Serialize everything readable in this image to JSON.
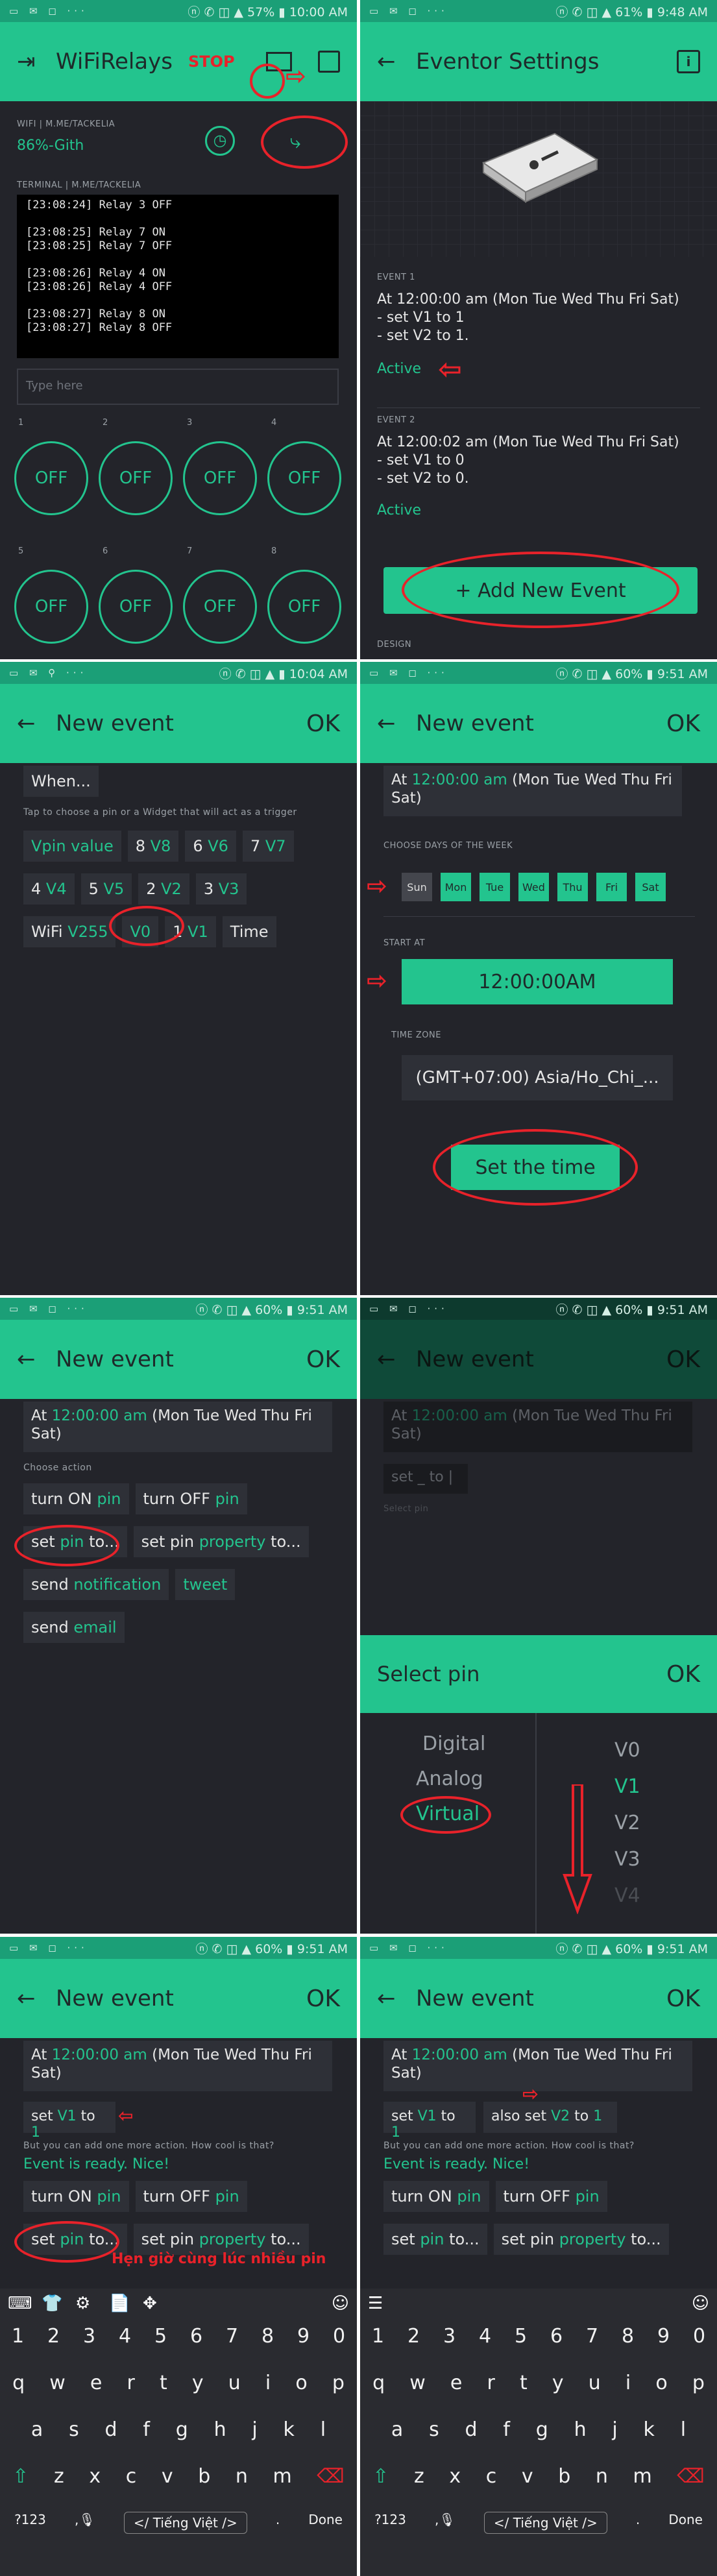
{
  "p1": {
    "status_left": "▭ ✉ ◻ ···",
    "status_right": "ⓝ ✆ ◫ ▲ 57% ▮ 10:00 AM",
    "title": "WiFiRelays",
    "stop_annotation": "STOP",
    "badge": "",
    "wifi_label": "WIFI | M.ME/TACKELIA",
    "wifi_value": "86%-Gith",
    "terminal_label": "TERMINAL | M.ME/TACKELIA",
    "terminal_lines": [
      "[23:08:24] Relay 3 OFF",
      "",
      "[23:08:25] Relay 7 ON",
      "[23:08:25] Relay 7 OFF",
      "",
      "[23:08:26] Relay 4 ON",
      "[23:08:26] Relay 4 OFF",
      "",
      "[23:08:27] Relay 8 ON",
      "[23:08:27] Relay 8 OFF"
    ],
    "type_here": "Type here",
    "knobs": [
      {
        "num": "1",
        "label": "OFF"
      },
      {
        "num": "2",
        "label": "OFF"
      },
      {
        "num": "3",
        "label": "OFF"
      },
      {
        "num": "4",
        "label": "OFF"
      },
      {
        "num": "5",
        "label": "OFF"
      },
      {
        "num": "6",
        "label": "OFF"
      },
      {
        "num": "7",
        "label": "OFF"
      },
      {
        "num": "8",
        "label": "OFF"
      }
    ]
  },
  "p2": {
    "status_left": "▭ ✉ ◻ ···",
    "status_right": "ⓝ ✆ ◫ ▲ 61% ▮ 9:48 AM",
    "title": "Eventor Settings",
    "info_icon": "i",
    "event1_label": "EVENT 1",
    "event1_lines": [
      "At 12:00:00 am (Mon Tue Wed Thu Fri Sat)",
      "- set V1 to 1",
      "- set V2 to 1."
    ],
    "event1_status": "Active",
    "event2_label": "EVENT 2",
    "event2_lines": [
      "At 12:00:02 am (Mon Tue Wed Thu Fri Sat)",
      "- set V1 to 0",
      "- set V2 to 0."
    ],
    "event2_status": "Active",
    "add_button": "+ Add New Event",
    "design_label": "DESIGN"
  },
  "p3": {
    "status_right": "ⓝ ✆ ◫ ▲ ▮ 10:04 AM",
    "title": "New event",
    "ok": "OK",
    "when": "When...",
    "hint": "Tap to choose a pin or a Widget that will act as a trigger",
    "chips": [
      {
        "a": "Vpin",
        "b": " value"
      },
      {
        "a": "8",
        "b": " V8"
      },
      {
        "a": "6",
        "b": " V6"
      },
      {
        "a": "7",
        "b": " V7"
      },
      {
        "a": "4",
        "b": " V4"
      },
      {
        "a": "5",
        "b": " V5"
      },
      {
        "a": "2",
        "b": " V2"
      },
      {
        "a": "3",
        "b": " V3"
      },
      {
        "a": "WiFi",
        "b": " V255"
      },
      {
        "a": "V0",
        "b": ""
      },
      {
        "a": "1",
        "b": " V1"
      },
      {
        "a": "Time",
        "b": ""
      }
    ]
  },
  "p4": {
    "status_right": "ⓝ ✆ ◫ ▲ 60% ▮ 9:51 AM",
    "title": "New event",
    "ok": "OK",
    "at_prefix": "At ",
    "at_time": "12:00:00 am",
    "at_suffix": " (Mon Tue Wed Thu Fri Sat)",
    "choose_days": "CHOOSE DAYS OF THE WEEK",
    "days": [
      "Sun",
      "Mon",
      "Tue",
      "Wed",
      "Thu",
      "Fri",
      "Sat"
    ],
    "start_at": "START AT",
    "start_value": "12:00:00AM",
    "tz_label": "TIME ZONE",
    "tz_value": "(GMT+07:00) Asia/Ho_Chi_...",
    "set_time": "Set the time"
  },
  "p5": {
    "status_right": "ⓝ ✆ ◫ ▲ 60% ▮ 9:51 AM",
    "title": "New event",
    "ok": "OK",
    "at_time": "12:00:00 am",
    "at_suffix": " (Mon Tue Wed Thu Fri Sat)",
    "choose_action": "Choose action",
    "actions": [
      {
        "a": "turn ON ",
        "b": "pin"
      },
      {
        "a": "turn OFF ",
        "b": "pin"
      },
      {
        "a": "set ",
        "b": "pin",
        "c": " to..."
      },
      {
        "a": "set pin ",
        "b": "property",
        "c": " to..."
      },
      {
        "a": "send ",
        "b": "notification"
      },
      {
        "a": "",
        "b": "tweet"
      },
      {
        "a": "send ",
        "b": "email"
      }
    ]
  },
  "p6": {
    "status_right": "ⓝ ✆ ◫ ▲ 60% ▮ 9:51 AM",
    "title": "New event",
    "ok": "OK",
    "at_time": "12:00:00 am",
    "at_suffix": " (Mon Tue Wed Thu Fri Sat)",
    "set_line": "set _ to |",
    "select_pin_hint": "Select pin",
    "select_pin_title": "Select pin",
    "types": [
      "Digital",
      "Analog",
      "Virtual"
    ],
    "pins": [
      "V0",
      "V1",
      "V2",
      "V3",
      "V4"
    ]
  },
  "p7": {
    "status_right": "ⓝ ✆ ◫ ▲ 60% ▮ 9:51 AM",
    "title": "New event",
    "ok": "OK",
    "at_time": "12:00:00 am",
    "at_suffix": " (Mon Tue Wed Thu Fri Sat)",
    "set_a": "set ",
    "set_pin": "V1",
    "set_b": " to ",
    "set_val": "1",
    "more_hint": "But you can add one more action. How cool is that?",
    "ready": "Event is ready. Nice!",
    "annotation": "Hẹn giờ cùng lúc nhiều pin",
    "actions": [
      {
        "a": "turn ON ",
        "b": "pin"
      },
      {
        "a": "turn OFF ",
        "b": "pin"
      },
      {
        "a": "set ",
        "b": "pin",
        "c": " to..."
      },
      {
        "a": "set pin ",
        "b": "property",
        "c": " to..."
      }
    ]
  },
  "p8": {
    "status_right": "ⓝ ✆ ◫ ▲ 60% ▮ 9:51 AM",
    "title": "New event",
    "ok": "OK",
    "at_time": "12:00:00 am",
    "at_suffix": " (Mon Tue Wed Thu Fri Sat)",
    "more_hint": "But you can add one more action. How cool is that?",
    "ready": "Event is ready. Nice!",
    "also_prefix": "also set ",
    "also_pin": "V2",
    "also_to": " to ",
    "also_val": "1",
    "actions": [
      {
        "a": "turn ON ",
        "b": "pin"
      },
      {
        "a": "turn OFF ",
        "b": "pin"
      },
      {
        "a": "set ",
        "b": "pin",
        "c": " to..."
      },
      {
        "a": "set pin ",
        "b": "property",
        "c": " to..."
      }
    ]
  },
  "keyboard": {
    "numbers": [
      "1",
      "2",
      "3",
      "4",
      "5",
      "6",
      "7",
      "8",
      "9",
      "0"
    ],
    "row1": [
      "q",
      "w",
      "e",
      "r",
      "t",
      "y",
      "u",
      "i",
      "o",
      "p"
    ],
    "row2": [
      "a",
      "s",
      "d",
      "f",
      "g",
      "h",
      "j",
      "k",
      "l"
    ],
    "row3": [
      "z",
      "x",
      "c",
      "v",
      "b",
      "n",
      "m"
    ],
    "sym": "?123",
    "comma": ",",
    "lang": "Tiếng Việt",
    "done": "Done"
  }
}
